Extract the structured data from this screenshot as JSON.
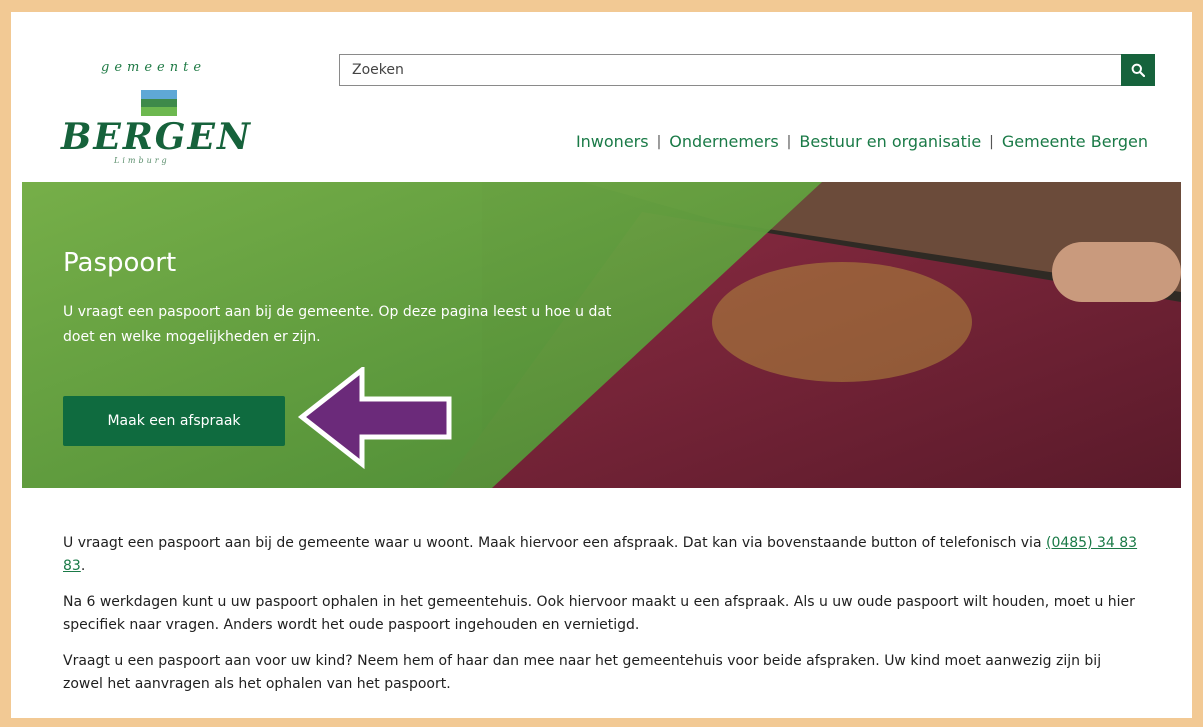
{
  "logo": {
    "small_text": "gemeente",
    "big_text": "BERGEN",
    "sub_text": "Limburg"
  },
  "search": {
    "placeholder": "Zoeken",
    "icon": "search-icon"
  },
  "nav": {
    "items": [
      "Inwoners",
      "Ondernemers",
      "Bestuur en organisatie",
      "Gemeente Bergen"
    ]
  },
  "hero": {
    "title": "Paspoort",
    "intro": "U vraagt een paspoort aan bij de gemeente. Op deze pagina leest u hoe u dat doet en welke mogelijkheden er zijn.",
    "cta_label": "Maak een afspraak"
  },
  "content": {
    "p1_before": "U vraagt een paspoort aan bij de gemeente waar u woont. Maak hiervoor een afspraak. Dat kan via bovenstaande button of telefonisch via ",
    "p1_link": "(0485) 34 83 83",
    "p1_after": ".",
    "p2": "Na 6 werkdagen kunt u uw paspoort ophalen in het gemeentehuis. Ook hiervoor maakt u een afspraak. Als u uw oude paspoort wilt houden, moet u hier specifiek naar vragen. Anders wordt het oude paspoort ingehouden en vernietigd.",
    "p3": "Vraagt u een paspoort aan voor uw kind? Neem hem of haar dan mee naar het gemeentehuis voor beide afspraken. Uw kind moet aanwezig zijn bij zowel het aanvragen als het ophalen van het paspoort."
  },
  "colors": {
    "frame": "#f2c994",
    "brand_green": "#16633c",
    "link_green": "#1a7a47",
    "arrow_purple": "#6b2a7a"
  }
}
